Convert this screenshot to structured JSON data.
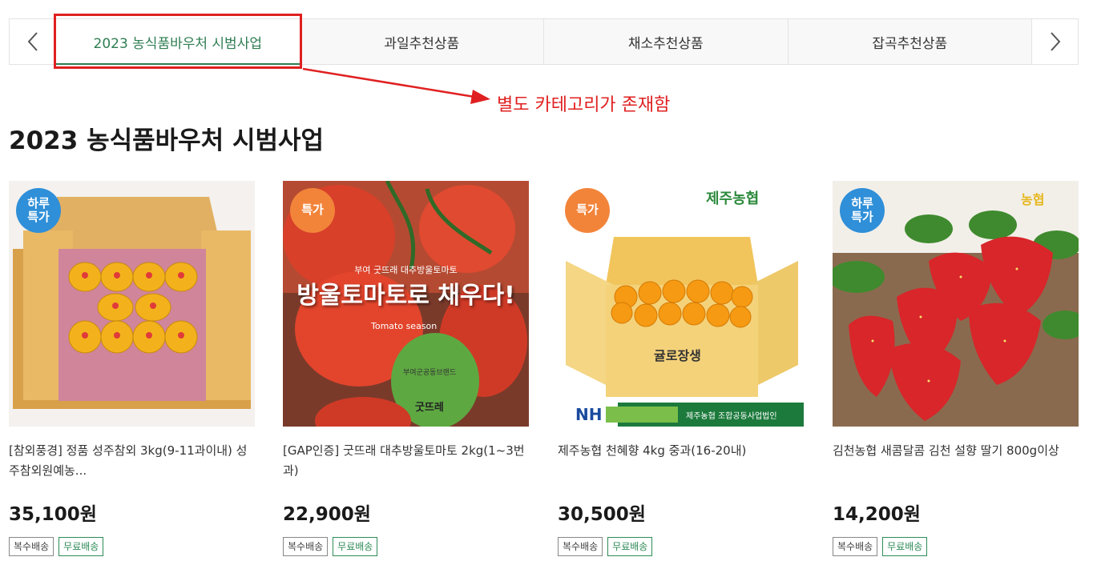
{
  "tabs": [
    {
      "label": "2023 농식품바우처 시범사업",
      "active": true
    },
    {
      "label": "과일추천상품",
      "active": false
    },
    {
      "label": "채소추천상품",
      "active": false
    },
    {
      "label": "잡곡추천상품",
      "active": false
    }
  ],
  "annotation": {
    "text": "별도 카테고리가 존재함",
    "color": "#e02020"
  },
  "section_title": "2023 농식품바우처 시범사업",
  "products": [
    {
      "badge": "하루\n특가",
      "badge_color": "blue",
      "name": "[참외풍경] 정품 성주참외 3kg(9-11과이내) 성주참외원예농...",
      "price": "35,100원",
      "tags": [
        "복수배송",
        "무료배송"
      ]
    },
    {
      "badge": "특가",
      "badge_color": "orange",
      "name": "[GAP인증] 굿뜨래 대추방울토마토 2kg(1~3번과)",
      "price": "22,900원",
      "tags": [
        "복수배송",
        "무료배송"
      ],
      "image_text": {
        "top": "부여 굿뜨래 대추방울토마토",
        "main": "방울토마토로 채우다!",
        "sub": "Tomato season",
        "brand_top": "부여군공동브랜드",
        "brand": "굿뜨레"
      }
    },
    {
      "badge": "특가",
      "badge_color": "orange",
      "name": "제주농협 천혜향 4kg 중과(16-20내)",
      "price": "30,500원",
      "tags": [
        "복수배송",
        "무료배송"
      ],
      "image_text": {
        "logo": "제주농협",
        "box": "귤로장생",
        "nh": "NH",
        "nh_sub": "제주농협 조합공동사업법인"
      }
    },
    {
      "badge": "하루\n특가",
      "badge_color": "blue",
      "name": "김천농협 새콤달콤 김천 설향 딸기 800g이상",
      "price": "14,200원",
      "tags": [
        "복수배송",
        "무료배송"
      ],
      "image_text": {
        "logo": "농협"
      }
    }
  ],
  "icons": {
    "prev": "chevron-left-icon",
    "next": "chevron-right-icon"
  },
  "colors": {
    "accent": "#2e7d52",
    "badge_blue": "#2f8fd8",
    "badge_orange": "#f2843a"
  }
}
